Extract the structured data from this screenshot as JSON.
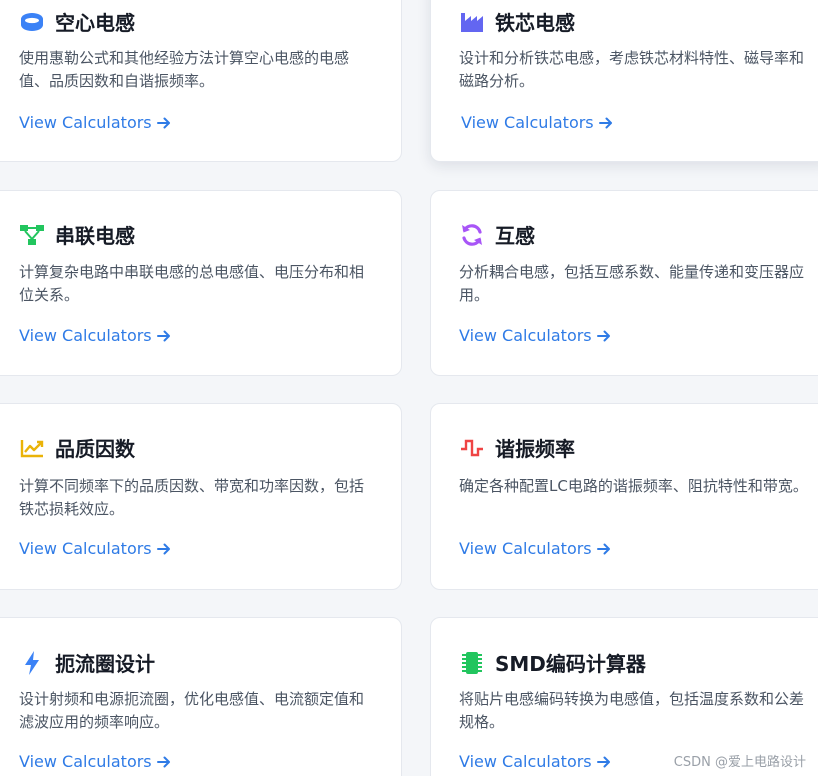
{
  "cards": [
    {
      "title": "空心电感",
      "icon": "coil-icon",
      "desc": "使用惠勒公式和其他经验方法计算空心电感的电感值、品质因数和自谐振频率。",
      "link": "View Calculators",
      "icon_color": "#3b82f6"
    },
    {
      "title": "铁芯电感",
      "icon": "industry-icon",
      "desc": "设计和分析铁芯电感，考虑铁芯材料特性、磁导率和磁路分析。",
      "link": "View Calculators",
      "icon_color": "#6366f1"
    },
    {
      "title": "串联电感",
      "icon": "network-icon",
      "desc": "计算复杂电路中串联电感的总电感值、电压分布和相位关系。",
      "link": "View Calculators",
      "icon_color": "#22c55e"
    },
    {
      "title": "互感",
      "icon": "sync-icon",
      "desc": "分析耦合电感，包括互感系数、能量传递和变压器应用。",
      "link": "View Calculators",
      "icon_color": "#a855f7"
    },
    {
      "title": "品质因数",
      "icon": "chart-line-icon",
      "desc": "计算不同频率下的品质因数、带宽和功率因数，包括铁芯损耗效应。",
      "link": "View Calculators",
      "icon_color": "#eab308"
    },
    {
      "title": "谐振频率",
      "icon": "wave-square-icon",
      "desc": "确定各种配置LC电路的谐振频率、阻抗特性和带宽。",
      "link": "View Calculators",
      "icon_color": "#ef4444"
    },
    {
      "title": "扼流圈设计",
      "icon": "bolt-icon",
      "desc": "设计射频和电源扼流圈，优化电感值、电流额定值和滤波应用的频率响应。",
      "link": "View Calculators",
      "icon_color": "#3b82f6"
    },
    {
      "title": "SMD编码计算器",
      "icon": "microchip-icon",
      "desc": "将贴片电感编码转换为电感值，包括温度系数和公差规格。",
      "link": "View Calculators",
      "icon_color": "#22c55e"
    }
  ],
  "watermark": "CSDN @爱上电路设计",
  "link_color": "#2f7be6"
}
